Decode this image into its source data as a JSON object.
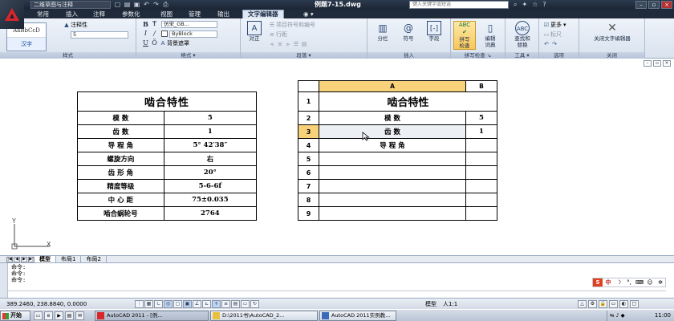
{
  "titlebar": {
    "workspace": "二维草图与注释",
    "document_title": "例题7-15.dwg",
    "search_placeholder": "键入关键字或短语"
  },
  "tabs": [
    {
      "label": "常用"
    },
    {
      "label": "插入"
    },
    {
      "label": "注释"
    },
    {
      "label": "参数化"
    },
    {
      "label": "视图"
    },
    {
      "label": "管理"
    },
    {
      "label": "输出"
    },
    {
      "label": "文字编辑器"
    }
  ],
  "ribbon": {
    "style": {
      "sample": "AaBbCcD",
      "style_name": "汉字",
      "annotative_label": "注释性",
      "height_value": "5",
      "panel_label": "样式"
    },
    "format": {
      "bold": "B",
      "italic": "I",
      "underline": "U",
      "overline": "Ō",
      "font": "仿宋_GB...",
      "color": "ByBlock",
      "mask": "背景遮罩",
      "panel_label": "格式"
    },
    "paragraph": {
      "justify": "对正",
      "bullets": "项目符号和编号",
      "line_spacing": "行距",
      "panel_label": "段落"
    },
    "insert": {
      "columns": "分栏",
      "symbol": "符号",
      "field": "字段",
      "panel_label": "插入"
    },
    "spell": {
      "check_line1": "拼写",
      "check_line2": "检查",
      "dict_line1": "编辑",
      "dict_line2": "词典",
      "panel_label": "拼写检查"
    },
    "tools": {
      "find_line1": "查找和",
      "find_line2": "替换",
      "panel_label": "工具"
    },
    "options": {
      "more": "更多",
      "ruler": "标尺",
      "panel_label": "选项"
    },
    "close": {
      "label": "关闭文字编辑器",
      "panel_label": "关闭"
    }
  },
  "left_table": {
    "title": "啮合特性",
    "rows": [
      [
        "模    数",
        "5"
      ],
      [
        "齿    数",
        "1"
      ],
      [
        "导 程 角",
        "5° 42′38″"
      ],
      [
        "螺旋方向",
        "右"
      ],
      [
        "齿 形 角",
        "20°"
      ],
      [
        "精度等级",
        "5-6-6f"
      ],
      [
        "中 心 距",
        "75±0.035"
      ],
      [
        "啮合蜗轮号",
        "2764"
      ]
    ]
  },
  "right_table": {
    "col_headers": [
      "A",
      "B"
    ],
    "row_numbers": [
      "1",
      "2",
      "3",
      "4",
      "5",
      "6",
      "7",
      "8",
      "9"
    ],
    "title": "啮合特性",
    "rows": [
      [
        "模    数",
        "5"
      ],
      [
        "齿    数",
        "1"
      ],
      [
        "导 程 角",
        ""
      ]
    ]
  },
  "ucs": {
    "x_label": "X",
    "y_label": "Y"
  },
  "layout_tabs": [
    "模型",
    "布局1",
    "布局2"
  ],
  "command": {
    "lines": [
      "命令:",
      "命令:",
      "命令:"
    ]
  },
  "statusbar": {
    "coords": "389.2460, 238.8840, 0.0000",
    "model": "模型",
    "scale": "人1:1"
  },
  "taskbar": {
    "start": "开始",
    "items": [
      "AutoCAD 2011 - [例...",
      "D:\\2011书\\AutoCAD_2...",
      "AutoCAD 2011实例教..."
    ],
    "clock": "11:00"
  },
  "colors": {
    "title_bg": "#1b2533",
    "ribbon_bg": "#dfe7f2",
    "header_highlight": "#f7d27a",
    "autocad_red": "#d8262d"
  }
}
